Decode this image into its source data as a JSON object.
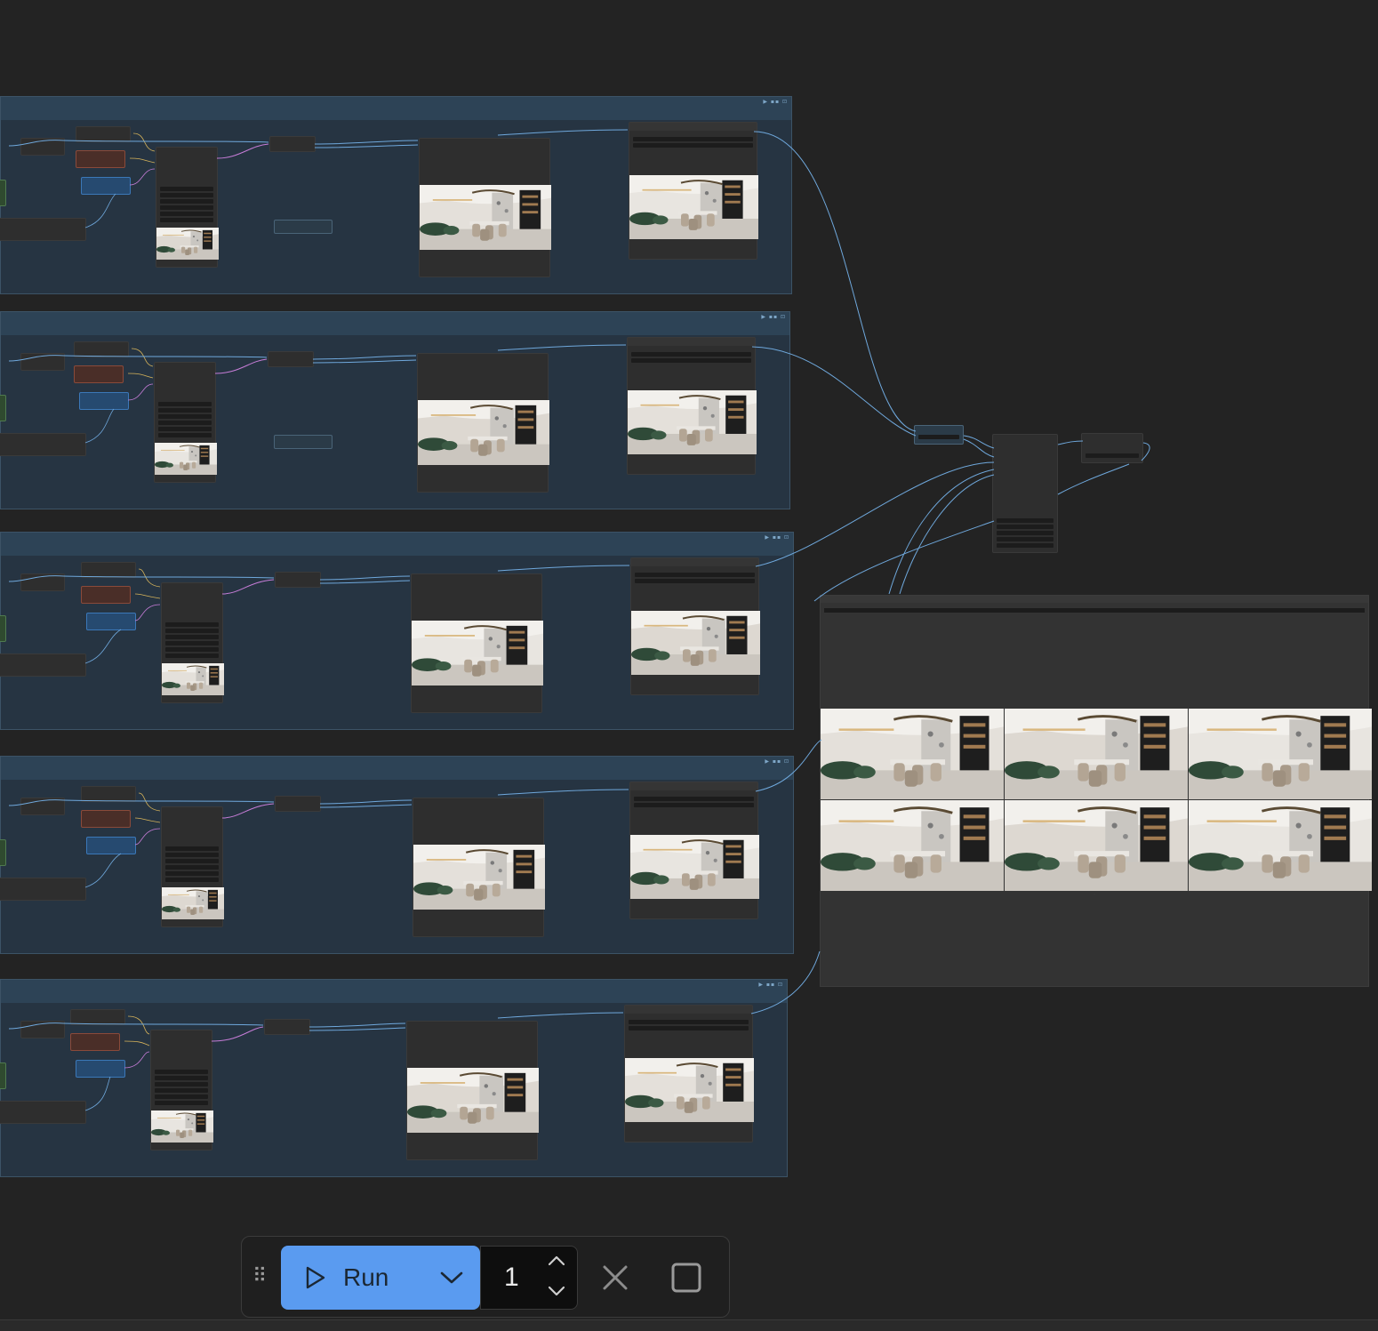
{
  "toolbar": {
    "run_label": "Run",
    "batch_count": "1",
    "icons": [
      "drag-handle-icon",
      "play-icon",
      "chevron-down-icon",
      "chevron-up-icon",
      "x-icon",
      "stop-square-icon"
    ]
  },
  "colors": {
    "canvas_bg": "#232323",
    "group_bg": "#263442",
    "group_header": "#2d4356",
    "link_blue": "#6fa8dc",
    "link_pink": "#c77dd8",
    "link_yellow": "#d6b35a",
    "run_button": "#5a9bf0"
  },
  "workflow": {
    "group_count": 5,
    "output_grid_columns": 3,
    "output_grid_rows": 2
  }
}
